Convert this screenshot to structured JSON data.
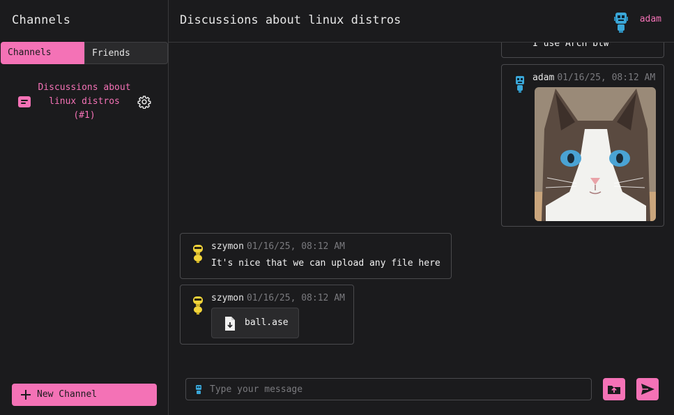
{
  "sidebar": {
    "title": "Channels",
    "tabs": [
      {
        "label": "Channels",
        "active": true
      },
      {
        "label": "Friends",
        "active": false
      }
    ],
    "channels": [
      {
        "name": "Discussions about linux distros",
        "id": "(#1)"
      }
    ],
    "new_channel_label": "New Channel"
  },
  "header": {
    "title": "Discussions about linux distros",
    "username": "adam"
  },
  "messages": [
    {
      "author": "",
      "text": "I use Arch btw",
      "partial": true
    },
    {
      "author": "adam",
      "time": "01/16/25, 08:12 AM",
      "attachment": "cat-image"
    },
    {
      "author": "szymon",
      "time": "01/16/25, 08:12 AM",
      "text": "It's nice that we can upload any file here"
    },
    {
      "author": "szymon",
      "time": "01/16/25, 08:12 AM",
      "file": "ball.ase"
    }
  ],
  "composer": {
    "placeholder": "Type your message"
  },
  "colors": {
    "accent": "#f472b6",
    "background": "#1b1b1d",
    "border": "#4a4a4d",
    "muted": "#7a7a7e"
  },
  "icons": [
    "message-icon",
    "gear-icon",
    "plus-icon",
    "robot-avatar-blue",
    "robot-avatar-yellow",
    "file-download-icon",
    "upload-icon",
    "send-icon"
  ]
}
